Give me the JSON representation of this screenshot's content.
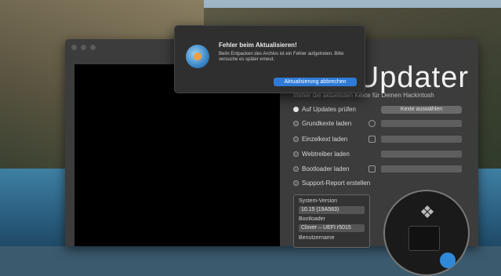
{
  "app": {
    "logo_text": "Updater",
    "subtitle": "Immer die aktuellsten Kexte für Deinen Hackintosh",
    "kexts_button": "Kexte auswählen",
    "options": [
      {
        "label": "Auf Updates prüfen",
        "selected": true
      },
      {
        "label": "Grundkexte laden",
        "selected": false
      },
      {
        "label": "Einzelkext laden",
        "selected": false
      },
      {
        "label": "Webtreiber laden",
        "selected": false
      },
      {
        "label": "Bootloader laden",
        "selected": false
      },
      {
        "label": "Support-Report erstellen",
        "selected": false
      }
    ],
    "info": {
      "system_label": "System-Version",
      "system_value": "10.15 (19A583)",
      "bootloader_label": "Bootloader",
      "bootloader_value": "Clover – UEFI r5015",
      "user_label": "Benutzername"
    }
  },
  "alert": {
    "title": "Fehler beim Aktualisieren!",
    "message": "Beim Entpacken des Archivs ist ein Fehler aufgetreten. Bitte versuche es später erneut.",
    "abort_button": "Aktualisierung abbrechen"
  },
  "colors": {
    "accent": "#2f7bd7",
    "window_bg": "#3c3c3c",
    "console_bg": "#000000"
  }
}
